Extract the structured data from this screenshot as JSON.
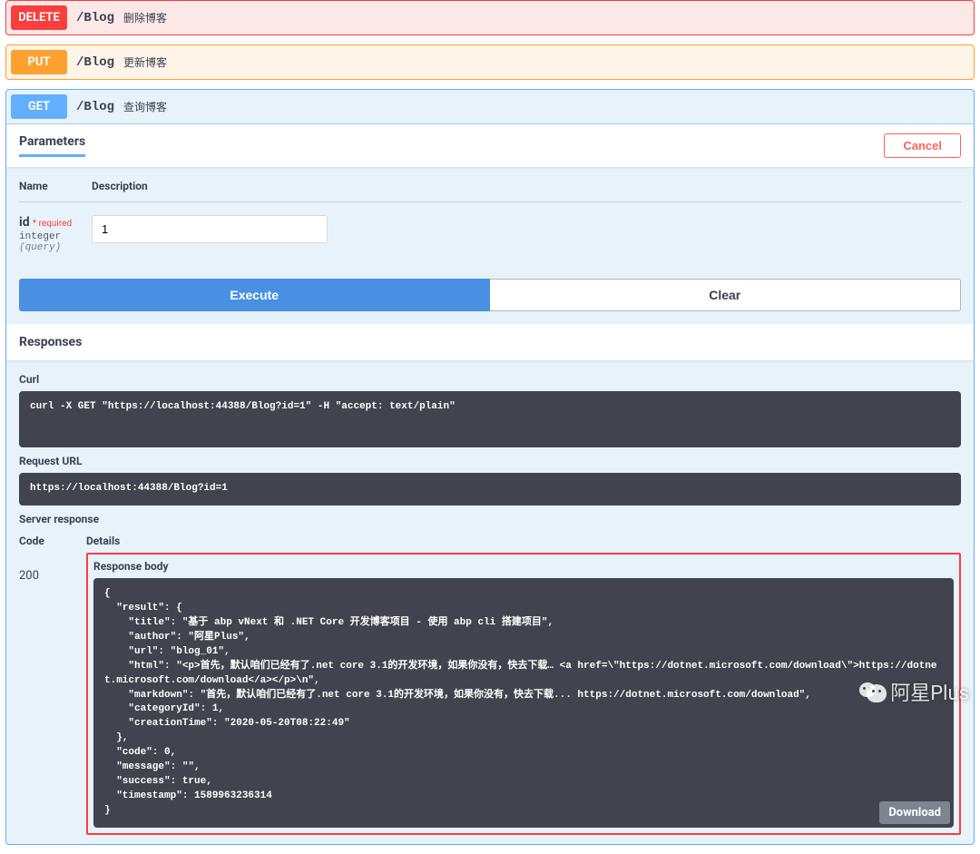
{
  "endpoints": {
    "delete": {
      "method": "DELETE",
      "path": "/Blog",
      "desc": "删除博客"
    },
    "put": {
      "method": "PUT",
      "path": "/Blog",
      "desc": "更新博客"
    },
    "get": {
      "method": "GET",
      "path": "/Blog",
      "desc": "查询博客"
    }
  },
  "parameters": {
    "header": "Parameters",
    "cancel": "Cancel",
    "col_name": "Name",
    "col_desc": "Description",
    "param": {
      "name": "id",
      "required": "* required",
      "type": "integer",
      "in": "(query)",
      "value": "1"
    }
  },
  "buttons": {
    "execute": "Execute",
    "clear": "Clear"
  },
  "responses": {
    "header": "Responses",
    "curl_label": "Curl",
    "curl": "curl -X GET \"https://localhost:44388/Blog?id=1\" -H \"accept: text/plain\"",
    "request_url_label": "Request URL",
    "request_url": "https://localhost:44388/Blog?id=1",
    "server_response_label": "Server response",
    "code_col": "Code",
    "details_col": "Details",
    "status": "200",
    "body_label": "Response body",
    "body": "{\n  \"result\": {\n    \"title\": \"基于 abp vNext 和 .NET Core 开发博客项目 - 使用 abp cli 搭建项目\",\n    \"author\": \"阿星Plus\",\n    \"url\": \"blog_01\",\n    \"html\": \"<p>首先，默认咱们已经有了.net core 3.1的开发环境，如果你没有，快去下载… <a href=\\\"https://dotnet.microsoft.com/download\\\">https://dotnet.microsoft.com/download</a></p>\\n\",\n    \"markdown\": \"首先，默认咱们已经有了.net core 3.1的开发环境，如果你没有，快去下载... https://dotnet.microsoft.com/download\",\n    \"categoryId\": 1,\n    \"creationTime\": \"2020-05-20T08:22:49\"\n  },\n  \"code\": 0,\n  \"message\": \"\",\n  \"success\": true,\n  \"timestamp\": 1589963236314\n}",
    "download": "Download"
  },
  "watermark": "阿星Plus"
}
